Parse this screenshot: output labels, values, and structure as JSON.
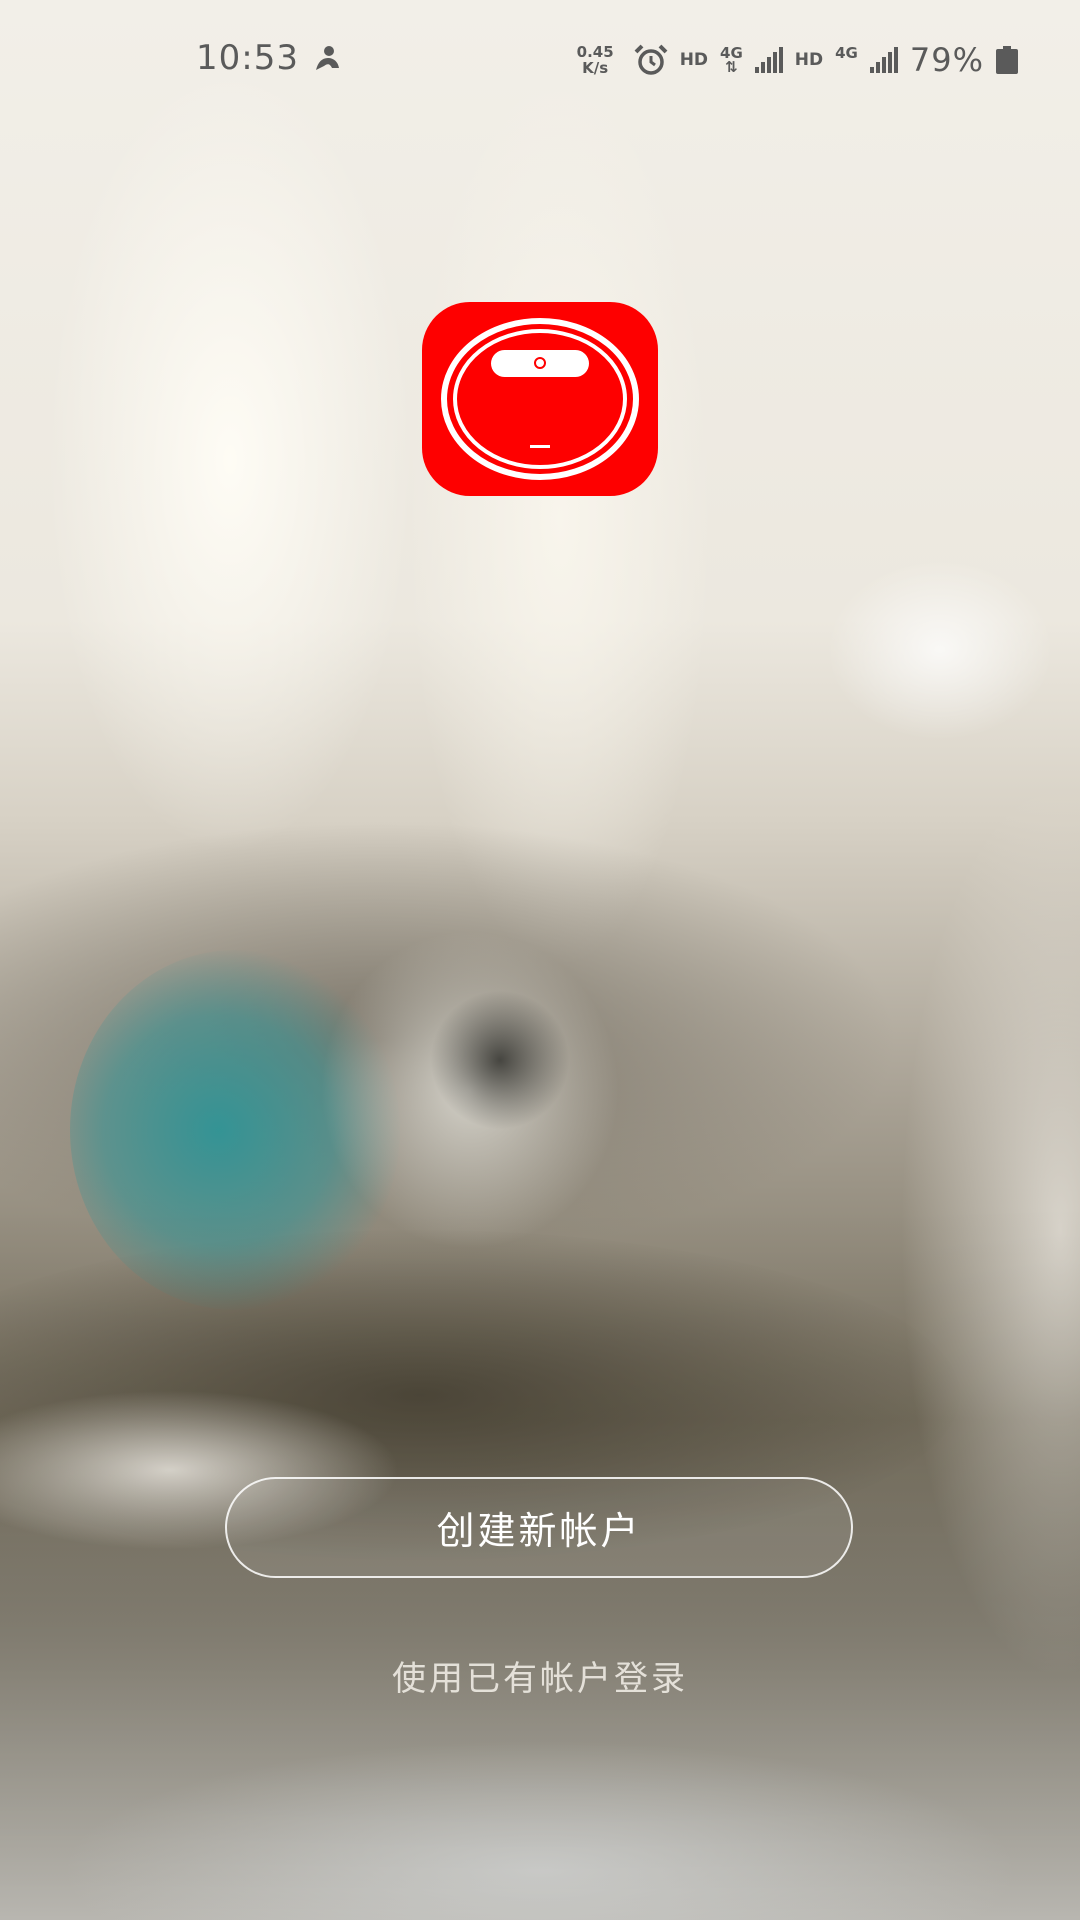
{
  "status_bar": {
    "time": "10:53",
    "net_speed_value": "0.45",
    "net_speed_unit": "K/s",
    "sim1_hd": "HD",
    "sim1_network": "4G",
    "sim2_hd": "HD",
    "sim2_network": "4G",
    "battery": "79%",
    "icons": [
      "notification-icon",
      "alarm-icon",
      "signal-icon",
      "battery-icon"
    ]
  },
  "app": {
    "logo_icon": "robot-vacuum-icon",
    "logo_color": "#fe0000"
  },
  "actions": {
    "create_account": "创建新帐户",
    "login_existing": "使用已有帐户登录"
  }
}
